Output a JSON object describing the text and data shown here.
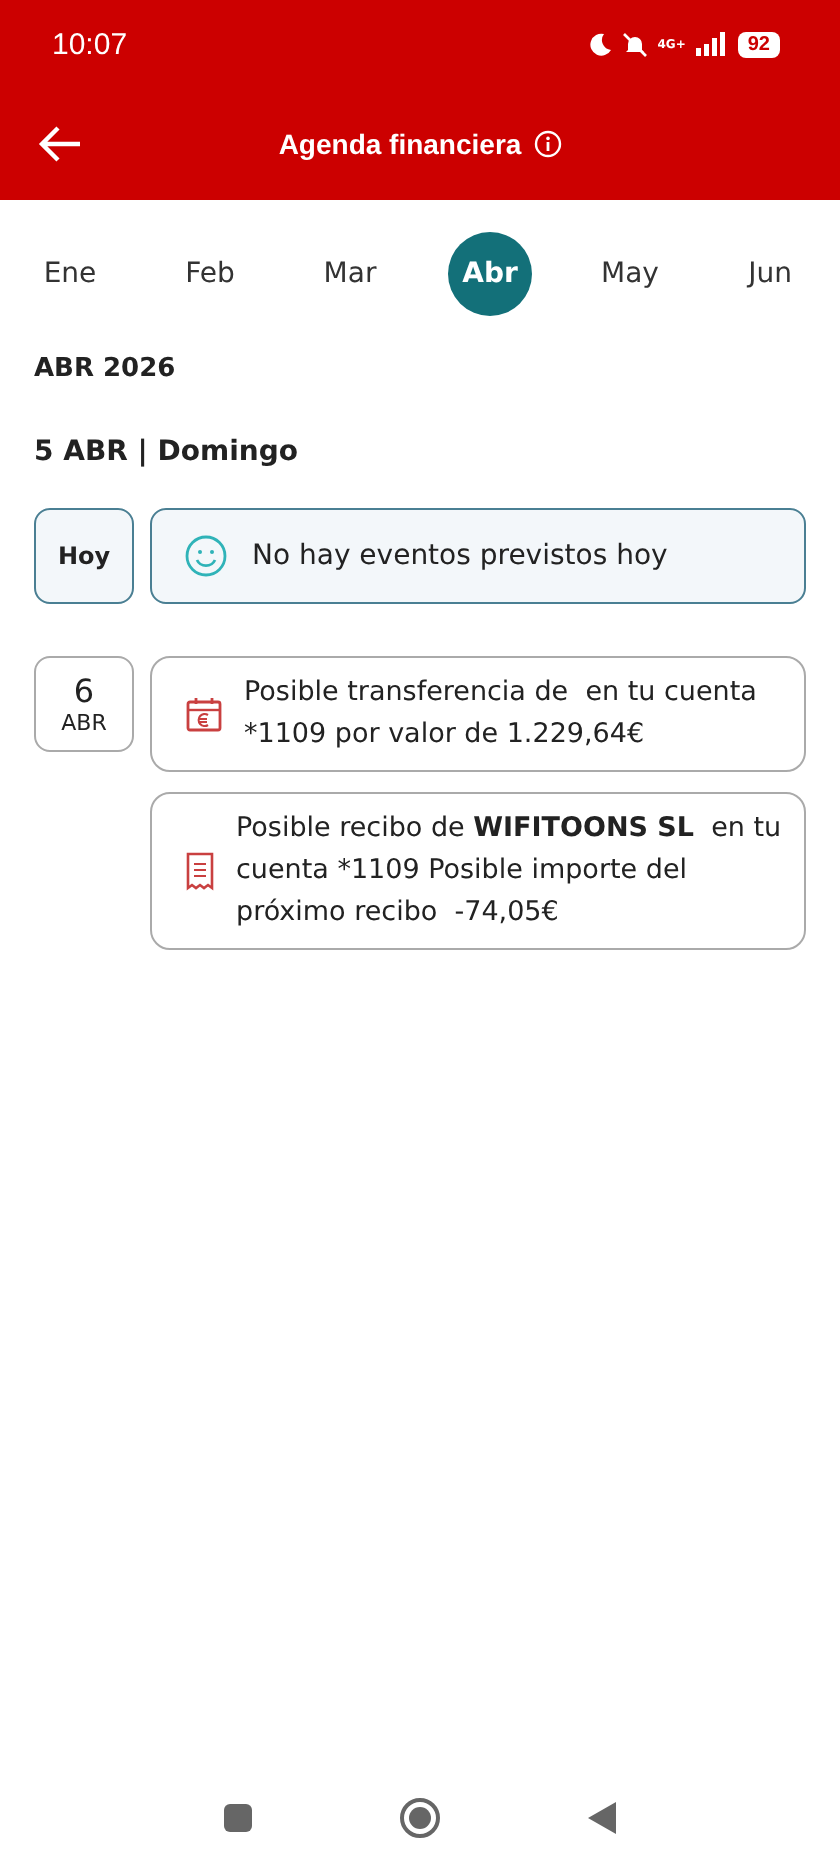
{
  "status_bar": {
    "time": "10:07",
    "network": "4G+",
    "battery": "92"
  },
  "header": {
    "title": "Agenda financiera"
  },
  "months": [
    {
      "label": "Ene",
      "selected": false
    },
    {
      "label": "Feb",
      "selected": false
    },
    {
      "label": "Mar",
      "selected": false
    },
    {
      "label": "Abr",
      "selected": true
    },
    {
      "label": "May",
      "selected": false
    },
    {
      "label": "Jun",
      "selected": false
    }
  ],
  "period": "ABR 2026",
  "day_heading": "5 ABR | Domingo",
  "today": {
    "label": "Hoy",
    "message": "No hay eventos previstos hoy"
  },
  "days": [
    {
      "day": "6",
      "month": "ABR",
      "events": [
        {
          "kind": "transfer",
          "text": "Posible transferencia de  en tu cuenta *1109 por valor de 1.229,64€"
        },
        {
          "kind": "receipt",
          "text": "Posible recibo de **WIFITOONS SL**  en tu cuenta *1109 Posible importe del próximo recibo  -74,05€"
        }
      ]
    }
  ]
}
